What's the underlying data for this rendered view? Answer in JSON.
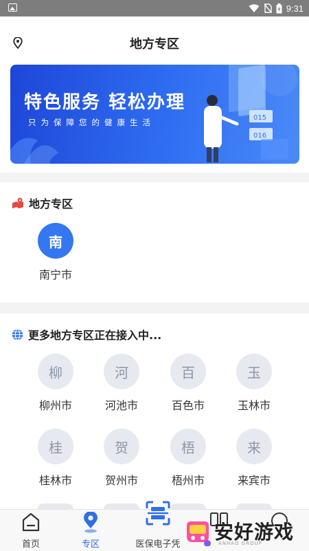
{
  "status_bar": {
    "time": "9:31"
  },
  "header": {
    "title": "地方专区"
  },
  "banner": {
    "headline": "特色服务 轻松办理",
    "tagline": "只为保障您的健康生活"
  },
  "region_section": {
    "title": "地方专区",
    "cities": [
      {
        "glyph": "南",
        "name": "南宁市"
      }
    ]
  },
  "more_section": {
    "title": "更多地方专区正在接入中...",
    "cities": [
      {
        "glyph": "柳",
        "name": "柳州市"
      },
      {
        "glyph": "河",
        "name": "河池市"
      },
      {
        "glyph": "百",
        "name": "百色市"
      },
      {
        "glyph": "玉",
        "name": "玉林市"
      },
      {
        "glyph": "桂",
        "name": "桂林市"
      },
      {
        "glyph": "贺",
        "name": "贺州市"
      },
      {
        "glyph": "梧",
        "name": "梧州市"
      },
      {
        "glyph": "来",
        "name": "来宾市"
      }
    ]
  },
  "tabbar": {
    "tabs": [
      {
        "label": "首页",
        "icon": "home-icon"
      },
      {
        "label": "专区",
        "icon": "location-pin-icon",
        "active": true
      },
      {
        "label": "医保电子凭",
        "icon": "scan-icon"
      }
    ]
  },
  "watermark": {
    "text": "安好游戏",
    "sub": "ANHAO GROUP"
  },
  "colors": {
    "accent": "#2f6fe8",
    "banner": "#2f6ef2",
    "inactive_circle": "#e6eaf0"
  }
}
